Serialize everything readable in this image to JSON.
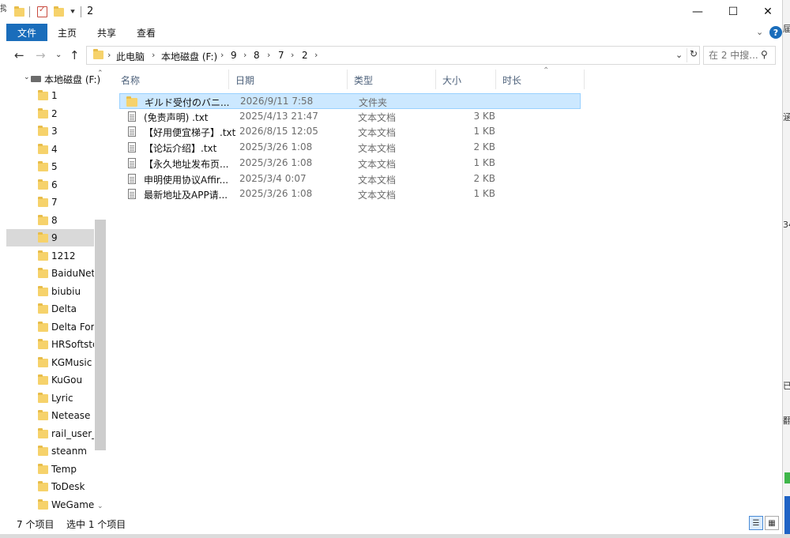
{
  "window": {
    "title": "2",
    "controls": {
      "minimize": "—",
      "maximize": "☐",
      "close": "✕"
    }
  },
  "ribbon": {
    "file_tab": "文件",
    "tabs": [
      "主页",
      "共享",
      "查看"
    ],
    "expand_icon": "chevron-down-icon",
    "help": "?"
  },
  "address": {
    "breadcrumbs": [
      "此电脑",
      "本地磁盘 (F:)",
      "9",
      "8",
      "7",
      "2"
    ],
    "refresh_icon": "refresh-icon"
  },
  "search": {
    "placeholder": "在 2 中搜..."
  },
  "nav_pane": {
    "drive_label": "本地磁盘 (F:)",
    "items": [
      "1",
      "2",
      "3",
      "4",
      "5",
      "6",
      "7",
      "8",
      "9",
      "1212",
      "BaiduNetdisk",
      "biubiu",
      "Delta",
      "Delta Force",
      "HRSoftstore",
      "KGMusic",
      "KuGou",
      "Lyric",
      "Netease",
      "rail_user_data",
      "steanm",
      "Temp",
      "ToDesk",
      "WeGameApps"
    ],
    "selected_item": "9"
  },
  "columns": {
    "name": "名称",
    "date": "日期",
    "type": "类型",
    "size": "大小",
    "duration": "时长"
  },
  "files": [
    {
      "name": "ギルド受付のバニ...",
      "date": "2026/9/11 7:58",
      "type": "文件夹",
      "size": "",
      "kind": "folder",
      "selected": true
    },
    {
      "name": "(免责声明) .txt",
      "date": "2025/4/13 21:47",
      "type": "文本文档",
      "size": "3 KB",
      "kind": "txt",
      "selected": false
    },
    {
      "name": "【好用便宜梯子】.txt",
      "date": "2026/8/15 12:05",
      "type": "文本文档",
      "size": "1 KB",
      "kind": "txt",
      "selected": false
    },
    {
      "name": "【论坛介绍】.txt",
      "date": "2025/3/26 1:08",
      "type": "文本文档",
      "size": "2 KB",
      "kind": "txt",
      "selected": false
    },
    {
      "name": "【永久地址发布页...",
      "date": "2025/3/26 1:08",
      "type": "文本文档",
      "size": "1 KB",
      "kind": "txt",
      "selected": false
    },
    {
      "name": "申明使用协议Affir...",
      "date": "2025/3/4 0:07",
      "type": "文本文档",
      "size": "2 KB",
      "kind": "txt",
      "selected": false
    },
    {
      "name": "最新地址及APP请...",
      "date": "2025/3/26 1:08",
      "type": "文本文档",
      "size": "1 KB",
      "kind": "txt",
      "selected": false
    }
  ],
  "status": {
    "item_count": "7 个项目",
    "selected_count": "选中 1 个项目"
  },
  "colors": {
    "accent": "#1a6dbb",
    "selection": "#cce8ff",
    "selection_border": "#99d1ff",
    "folder": "#f6d26b"
  }
}
